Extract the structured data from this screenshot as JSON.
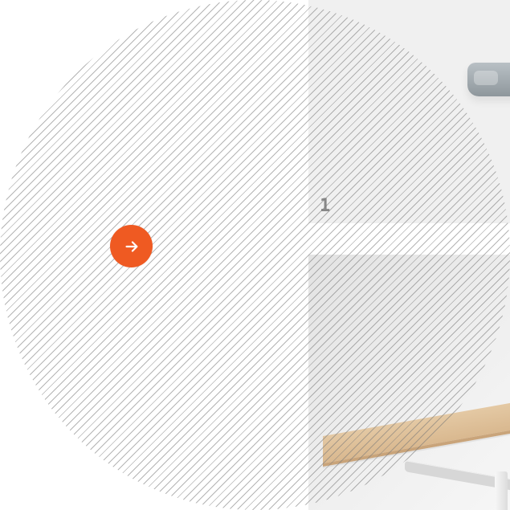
{
  "hero": {
    "cta_label": "",
    "cta_icon": "arrow-right-icon",
    "accent_color": "#ef5a22"
  },
  "gallery": {
    "item_1": {
      "index_label": "1"
    }
  }
}
